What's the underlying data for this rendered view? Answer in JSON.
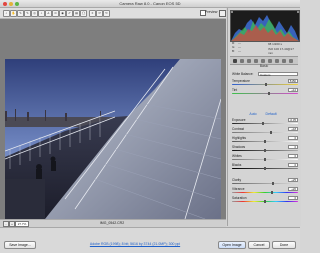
{
  "window": {
    "title": "Camera Raw 8.0 - Canon EOS 5D"
  },
  "toolbar": {
    "preview_label": "Preview"
  },
  "canvas": {
    "zoom_minus": "-",
    "zoom_plus": "+",
    "zoom_value": "27.7%",
    "filename": "IMG_0542.CR2"
  },
  "histogram": {
    "r_label": "R:",
    "g_label": "G:",
    "b_label": "B:",
    "r_value": "---",
    "g_value": "---",
    "b_value": "---",
    "info_1": "f/8  1/200 s",
    "info_2": "ISO 100  17-40@17 mm"
  },
  "panel": {
    "section_title": "Basic",
    "white_balance_label": "White Balance:",
    "white_balance_value": "Custom",
    "auto_label": "Auto",
    "default_label": "Default",
    "sliders": [
      {
        "label": "Temperature",
        "value": "5150"
      },
      {
        "label": "Tint",
        "value": "+12"
      },
      {
        "label": "Exposure",
        "value": "-0.35"
      },
      {
        "label": "Contrast",
        "value": "+18"
      },
      {
        "label": "Highlights",
        "value": "0"
      },
      {
        "label": "Shadows",
        "value": "0"
      },
      {
        "label": "Whites",
        "value": "0"
      },
      {
        "label": "Blacks",
        "value": "0"
      },
      {
        "label": "Clarity",
        "value": "+25"
      },
      {
        "label": "Vibrance",
        "value": "+20"
      },
      {
        "label": "Saturation",
        "value": "0"
      }
    ]
  },
  "bottom": {
    "save_label": "Save Image...",
    "workflow_text": "Adobe RGB (1998); 8 bit; 5616 by 3744 (21.0MP); 300 ppi",
    "open_label": "Open Image",
    "cancel_label": "Cancel",
    "done_label": "Done"
  },
  "colors": {
    "accent_link": "#1d5fc9",
    "photo_sky": "#3c4f8a"
  }
}
